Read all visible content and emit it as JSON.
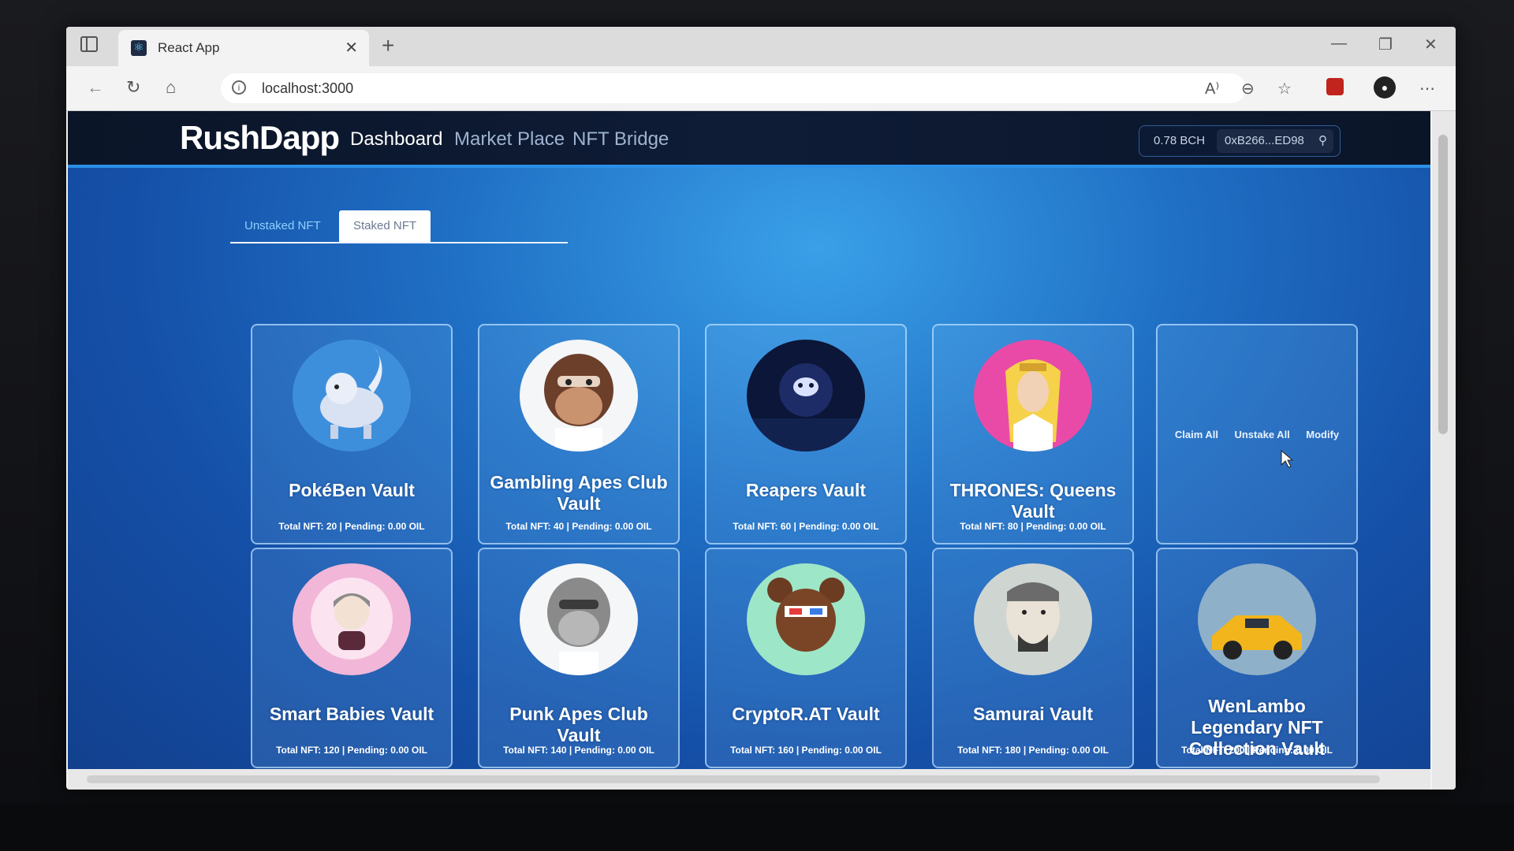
{
  "browser": {
    "tab_title": "React App",
    "url": "localhost:3000"
  },
  "app": {
    "logo": "RushDapp",
    "nav": [
      "Dashboard",
      "Market Place",
      "NFT Bridge"
    ],
    "wallet": {
      "balance": "0.78 BCH",
      "address": "0xB266...ED98"
    }
  },
  "tabs": {
    "unstaked": "Unstaked NFT",
    "staked": "Staked NFT"
  },
  "actions": {
    "claim": "Claim All",
    "unstake": "Unstake All",
    "modify": "Modify"
  },
  "vaults": [
    {
      "title": "PokéBen Vault",
      "stats": "Total NFT: 20 | Pending: 0.00 OIL"
    },
    {
      "title": "Gambling Apes Club Vault",
      "stats": "Total NFT: 40 | Pending: 0.00 OIL"
    },
    {
      "title": "Reapers Vault",
      "stats": "Total NFT: 60 | Pending: 0.00 OIL"
    },
    {
      "title": "THRONES: Queens Vault",
      "stats": "Total NFT: 80 | Pending: 0.00 OIL"
    },
    {
      "title": "Smart Babies Vault",
      "stats": "Total NFT: 120 | Pending: 0.00 OIL"
    },
    {
      "title": "Punk Apes Club Vault",
      "stats": "Total NFT: 140 | Pending: 0.00 OIL"
    },
    {
      "title": "CryptoR.AT Vault",
      "stats": "Total NFT: 160 | Pending: 0.00 OIL"
    },
    {
      "title": "Samurai Vault",
      "stats": "Total NFT: 180 | Pending: 0.00 OIL"
    },
    {
      "title": "WenLambo Legendary NFT Collection Vault",
      "stats": "Total NFT: 200 | Pending: 0.00 OIL"
    }
  ],
  "icons": {
    "sidebar": "sidebar-icon",
    "close": "close-icon",
    "back": "back-arrow-icon",
    "refresh": "refresh-icon",
    "home": "home-icon",
    "info": "info-icon",
    "read_aloud": "read-aloud-icon",
    "zoom": "zoom-out-icon",
    "favorite": "favorite-icon",
    "profile": "profile-icon",
    "wallet_user": "user-icon"
  },
  "colors": {
    "accent": "#2b8fe6",
    "header_bg": "#0e1c36",
    "page_bg": "#1f6fc4"
  }
}
